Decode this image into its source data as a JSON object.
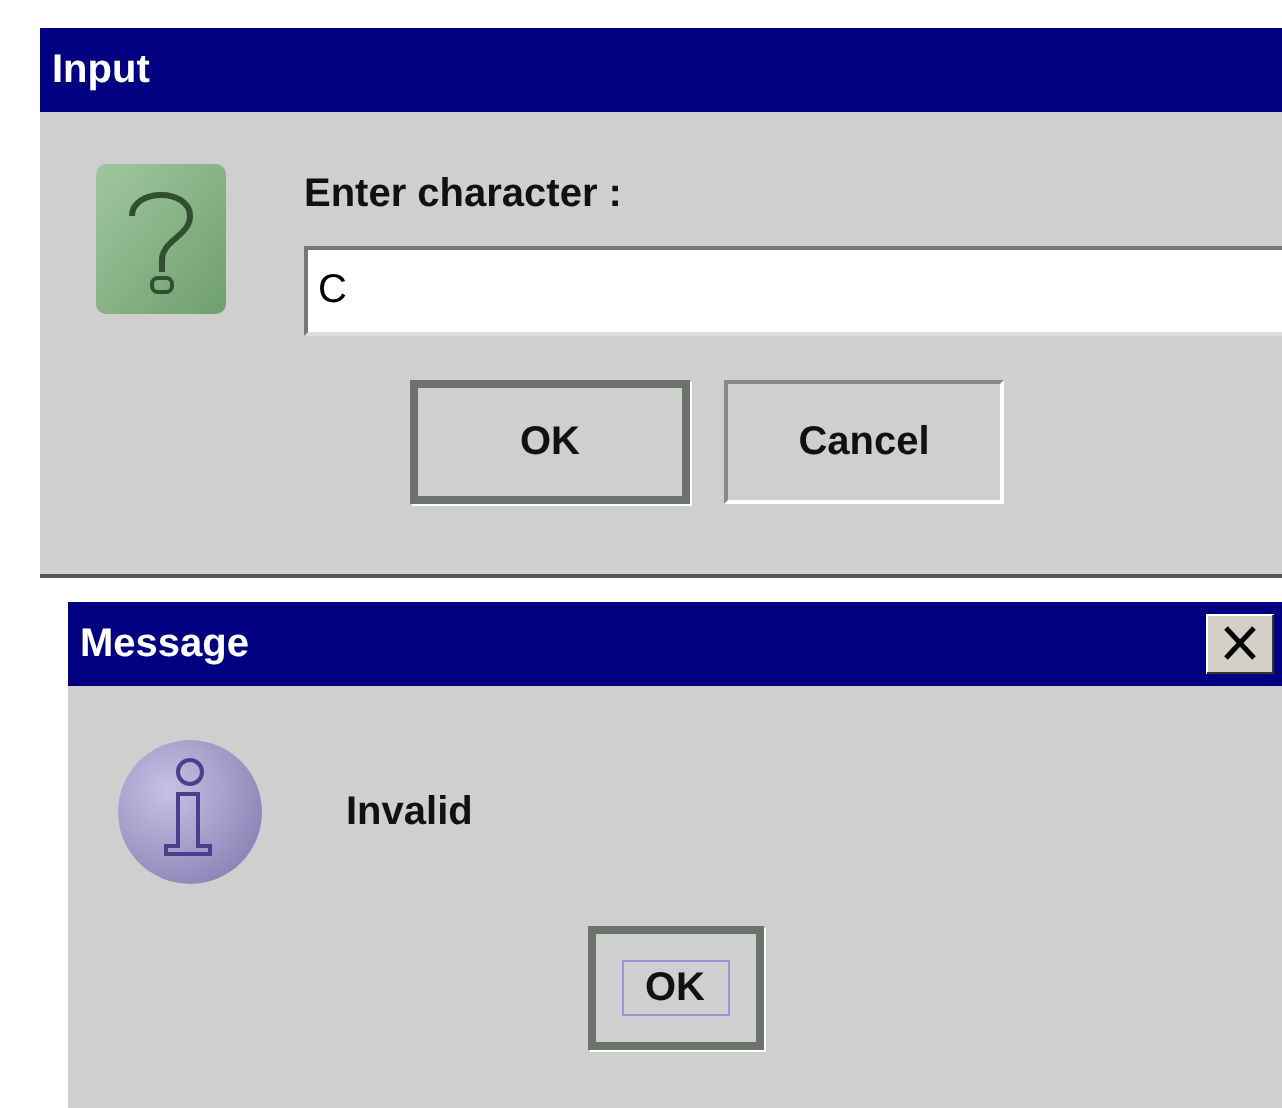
{
  "input_dialog": {
    "title": "Input",
    "prompt": "Enter character :",
    "field": {
      "value": "C"
    },
    "buttons": [
      {
        "label": "OK",
        "default": true
      },
      {
        "label": "Cancel",
        "default": false
      }
    ]
  },
  "message_dialog": {
    "title": "Message",
    "message": "Invalid",
    "buttons": [
      {
        "label": "OK",
        "default": true,
        "focused": true
      }
    ]
  }
}
